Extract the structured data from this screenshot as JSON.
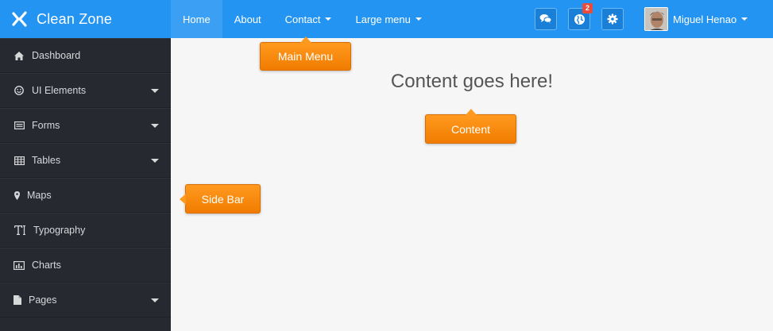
{
  "brand": {
    "name": "Clean Zone"
  },
  "nav": {
    "items": [
      {
        "label": "Home"
      },
      {
        "label": "About"
      },
      {
        "label": "Contact"
      },
      {
        "label": "Large menu"
      }
    ]
  },
  "toolbar": {
    "notification_count": "2"
  },
  "user": {
    "name": "Miguel Henao"
  },
  "sidebar": {
    "items": [
      {
        "label": "Dashboard",
        "icon": "home-icon"
      },
      {
        "label": "UI Elements",
        "icon": "smile-icon"
      },
      {
        "label": "Forms",
        "icon": "form-icon"
      },
      {
        "label": "Tables",
        "icon": "table-icon"
      },
      {
        "label": "Maps",
        "icon": "map-marker-icon"
      },
      {
        "label": "Typography",
        "icon": "typography-icon"
      },
      {
        "label": "Charts",
        "icon": "chart-icon"
      },
      {
        "label": "Pages",
        "icon": "file-icon"
      }
    ]
  },
  "content": {
    "title": "Content goes here!"
  },
  "callouts": {
    "main_menu": "Main Menu",
    "content": "Content",
    "side_bar": "Side Bar"
  },
  "colors": {
    "topbar": "#2494f2",
    "sidebar": "#272930",
    "callout": "#f58a0a"
  }
}
